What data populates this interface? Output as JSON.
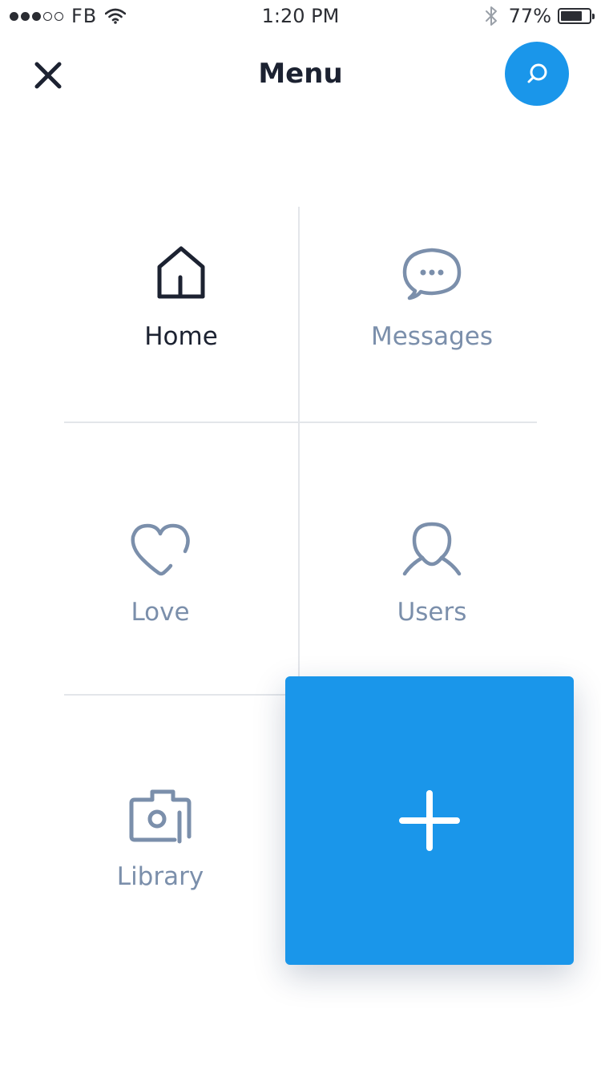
{
  "status_bar": {
    "carrier": "FB",
    "time": "1:20 PM",
    "battery": "77%",
    "battery_level": 0.77,
    "signal_bars_filled": 3,
    "signal_bars_total": 5
  },
  "header": {
    "title": "Menu"
  },
  "menu": {
    "items": [
      {
        "label": "Home",
        "icon": "home-icon",
        "active": true
      },
      {
        "label": "Messages",
        "icon": "chat-bubble-icon",
        "active": false
      },
      {
        "label": "Love",
        "icon": "heart-icon",
        "active": false
      },
      {
        "label": "Users",
        "icon": "user-icon",
        "active": false
      },
      {
        "label": "Library",
        "icon": "camera-icon",
        "active": false
      }
    ]
  },
  "fab": {
    "icon": "plus-icon"
  },
  "colors": {
    "accent": "#1a96ea",
    "active_text": "#1c2231",
    "inactive_text": "#7b8fab",
    "divider": "#e3e6ea"
  }
}
